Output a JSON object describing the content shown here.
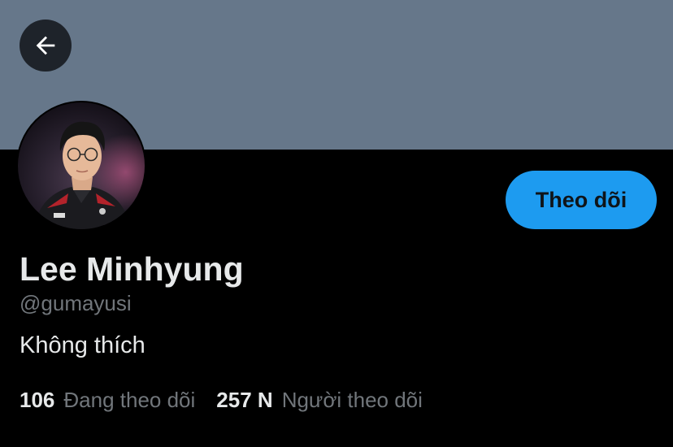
{
  "profile": {
    "display_name": "Lee Minhyung",
    "handle": "@gumayusi",
    "bio": "Không thích",
    "follow_button_label": "Theo dõi"
  },
  "stats": {
    "following_count": "106",
    "following_label": "Đang theo dõi",
    "followers_count": "257 N",
    "followers_label": "Người theo dõi"
  },
  "icons": {
    "back": "arrow-left-icon",
    "avatar": "profile-photo"
  },
  "colors": {
    "banner": "#66778a",
    "background": "#000000",
    "accent": "#1d9bf0",
    "primary_text": "#e7e9ea",
    "secondary_text": "#71767b"
  }
}
